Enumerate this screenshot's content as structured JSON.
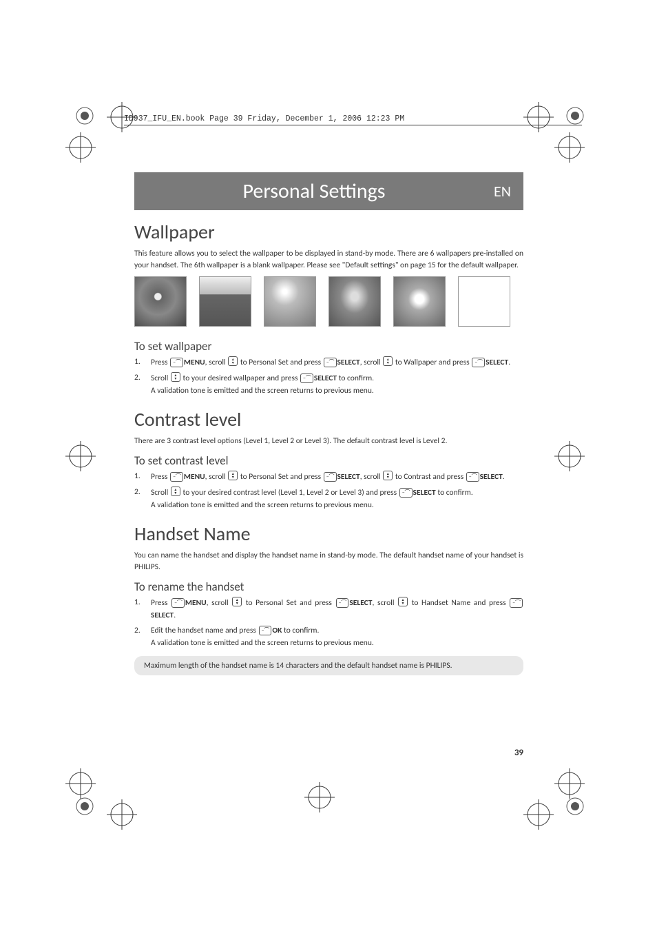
{
  "header_line": "ID937_IFU_EN.book  Page 39  Friday, December 1, 2006  12:23 PM",
  "title_bar": {
    "title": "Personal Settings",
    "lang": "EN"
  },
  "wallpaper": {
    "heading": "Wallpaper",
    "intro": "This feature allows you to select the wallpaper to be displayed in stand-by mode. There are 6 wallpapers pre-installed on your handset. The 6th wallpaper is a blank wallpaper. Please see \"Default settings\" on page 15 for the default wallpaper.",
    "sub": "To set wallpaper",
    "step1_a": "Press ",
    "step1_b": "MENU",
    "step1_c": ", scroll ",
    "step1_d": " to Personal Set and press ",
    "step1_e": "SELECT",
    "step1_f": ", scroll ",
    "step1_g": " to Wallpaper and press ",
    "step1_h": "SELECT",
    "step1_i": ".",
    "step2_a": "Scroll ",
    "step2_b": " to your desired wallpaper and press ",
    "step2_c": "SELECT",
    "step2_d": " to confirm.",
    "step2_e": "A validation tone is emitted and the screen returns to previous menu."
  },
  "contrast": {
    "heading": "Contrast level",
    "intro": "There are 3 contrast level options (Level 1, Level 2 or Level 3). The default contrast level is Level 2.",
    "sub": "To set contrast level",
    "step1_a": "Press ",
    "step1_b": "MENU",
    "step1_c": ", scroll ",
    "step1_d": " to Personal Set and press ",
    "step1_e": "SELECT",
    "step1_f": ", scroll ",
    "step1_g": " to Contrast and press ",
    "step1_h": "SELECT",
    "step1_i": ".",
    "step2_a": "Scroll ",
    "step2_b": " to your desired contrast level (Level 1, Level 2 or Level 3) and press ",
    "step2_c": "SELECT",
    "step2_d": " to confirm.",
    "step2_e": "A validation tone is emitted and the screen returns to previous menu."
  },
  "handset": {
    "heading": "Handset Name",
    "intro": "You can name the handset and display the handset name in stand-by mode. The default handset name of your handset is PHILIPS.",
    "sub": "To rename the handset",
    "step1_a": "Press ",
    "step1_b": "MENU",
    "step1_c": ", scroll ",
    "step1_d": " to Personal Set and press ",
    "step1_e": "SELECT",
    "step1_f": ", scroll ",
    "step1_g": " to Handset Name and press ",
    "step1_h": "SELECT",
    "step1_i": ".",
    "step2_a": "Edit the handset name and press ",
    "step2_b": "OK",
    "step2_c": " to confirm.",
    "step2_d": "A validation tone is emitted and the screen returns to previous menu.",
    "note": "Maximum length of the handset name is 14 characters and the default handset name is PHILIPS."
  },
  "page_number": "39"
}
